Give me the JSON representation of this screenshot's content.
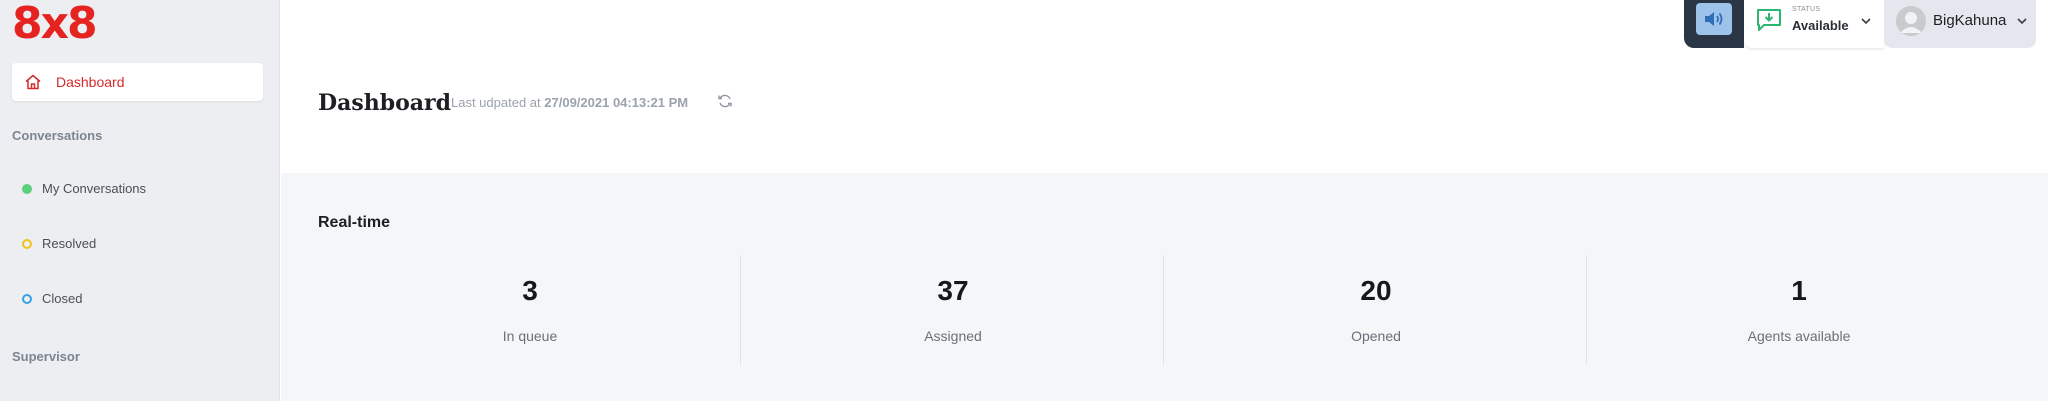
{
  "brand": {
    "logo_text": "8x8",
    "color": "#e52321"
  },
  "sidebar": {
    "active_item": {
      "label": "Dashboard",
      "icon": "home-icon"
    },
    "sections": [
      {
        "title": "Conversations"
      },
      {
        "title": "Supervisor"
      }
    ],
    "conversation_items": [
      {
        "label": "My Conversations",
        "status_color": "#5ccf7e"
      },
      {
        "label": "Resolved",
        "status_color": "#f0c419"
      },
      {
        "label": "Closed",
        "status_color": "#3aa0e0"
      }
    ]
  },
  "topbar": {
    "speaker_icon": "speaker-icon",
    "status": {
      "caption": "STATUS",
      "value": "Available",
      "icon": "status-chat-icon"
    },
    "user": {
      "name": "BigKahuna",
      "icon": "avatar-icon"
    }
  },
  "header": {
    "title": "Dashboard",
    "last_updated_prefix": "Last udpated at",
    "last_updated_value": "27/09/2021 04:13:21 PM",
    "refresh_icon": "refresh-icon"
  },
  "realtime": {
    "title": "Real-time",
    "stats": [
      {
        "value": "3",
        "label": "In queue"
      },
      {
        "value": "37",
        "label": "Assigned"
      },
      {
        "value": "20",
        "label": "Opened"
      },
      {
        "value": "1",
        "label": "Agents available"
      }
    ]
  }
}
